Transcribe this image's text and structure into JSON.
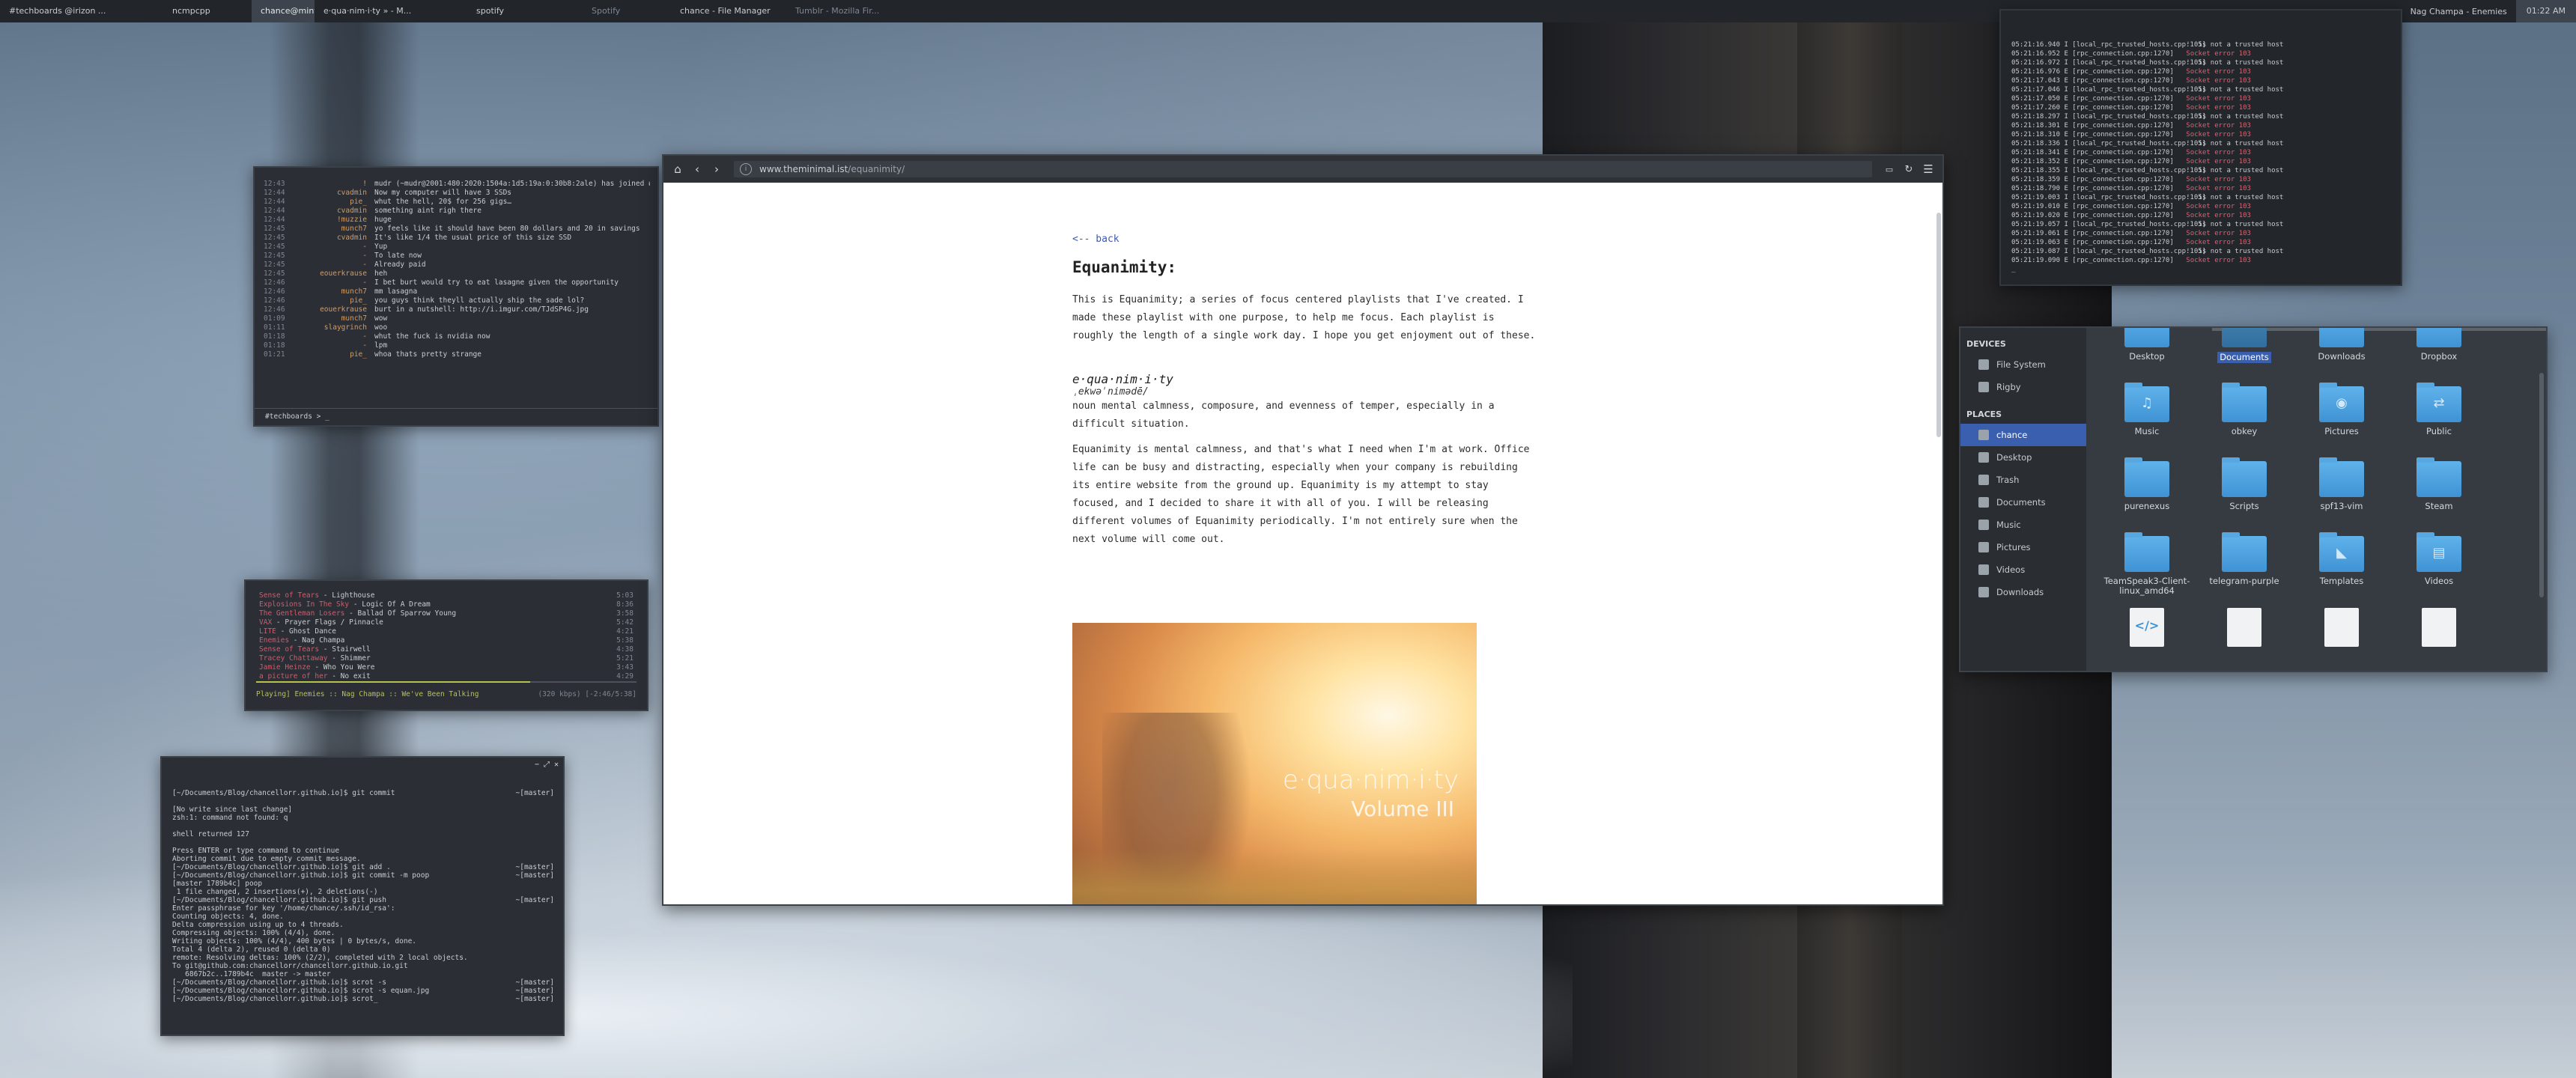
{
  "topbar": {
    "tabs": [
      "#techboards @irizon ...",
      "ncmpcpp",
      "chance@mintyfresh: ~",
      "e·qua·nim·i·ty » - M...",
      "spotify",
      "Spotify",
      "chance - File Manager",
      "Tumblr - Mozilla Fir..."
    ],
    "now_playing": "Nag Champa - Enemies",
    "clock": "01:22 AM"
  },
  "irc": {
    "lines": [
      {
        "t": "12:43",
        "n": "!",
        "m": "mudr (~mudr@2001:480:2020:1504a:1d5:19a:0:30b8:2ale) has joined #techboards"
      },
      {
        "t": "12:44",
        "n": "cvadmin",
        "m": "Now my computer will have 3 SSDs"
      },
      {
        "t": "12:44",
        "n": "pie_",
        "m": "whut the hell, 20$ for 256 gigs…"
      },
      {
        "t": "12:44",
        "n": "cvadmin",
        "m": "something aint righ there"
      },
      {
        "t": "12:44",
        "n": "!muzzie",
        "m": "huge"
      },
      {
        "t": "12:45",
        "n": "munch7",
        "m": "yo feels like it should have been 80 dollars and 20 in savings"
      },
      {
        "t": "12:45",
        "n": "cvadmin",
        "m": "It's like 1/4 the usual price of this size SSD"
      },
      {
        "t": "12:45",
        "n": "-",
        "m": "Yup"
      },
      {
        "t": "12:45",
        "n": "-",
        "m": "To late now"
      },
      {
        "t": "12:45",
        "n": "-",
        "m": "Already paid"
      },
      {
        "t": "12:45",
        "n": "eouerkrause",
        "m": "heh"
      },
      {
        "t": "12:46",
        "n": "-",
        "m": "I bet burt would try to eat lasagne given the opportunity"
      },
      {
        "t": "12:46",
        "n": "munch7",
        "m": "mm lasagna"
      },
      {
        "t": "12:46",
        "n": "pie_",
        "m": "you guys think theyll actually ship the sade lol?"
      },
      {
        "t": "12:46",
        "n": "eouerkrause",
        "m": "burt in a nutshell: http://i.imgur.com/TJdSP4G.jpg"
      },
      {
        "t": "01:09",
        "n": "munch7",
        "m": "wow"
      },
      {
        "t": "01:11",
        "n": "slaygrinch",
        "m": "woo"
      },
      {
        "t": "01:18",
        "n": "-",
        "m": "whut the fuck is nvidia now"
      },
      {
        "t": "01:18",
        "n": "-",
        "m": "lpm"
      },
      {
        "t": "01:21",
        "n": "pie_",
        "m": "whoa thats pretty strange"
      }
    ],
    "input": "#techboards > _"
  },
  "music": {
    "tracks": [
      {
        "artist": "Sense of Tears",
        "song": " - Lighthouse",
        "dur": "5:03"
      },
      {
        "artist": "Explosions In The Sky",
        "song": " - Logic Of A Dream",
        "dur": "8:36"
      },
      {
        "artist": "The Gentleman Losers",
        "song": " - Ballad Of Sparrow Young",
        "dur": "3:58"
      },
      {
        "artist": "VAX",
        "song": " - Prayer Flags / Pinnacle",
        "dur": "5:42"
      },
      {
        "artist": "LITE",
        "song": " - Ghost Dance",
        "dur": "4:21"
      },
      {
        "artist": "Enemies",
        "song": " - Nag Champa",
        "dur": "5:38"
      },
      {
        "artist": "Sense of Tears",
        "song": " - Stairwell",
        "dur": "4:38"
      },
      {
        "artist": "Tracey Chattaway",
        "song": " - Shimmer",
        "dur": "5:21"
      },
      {
        "artist": "Jamie Heinze",
        "song": " - Who You Were",
        "dur": "3:43"
      },
      {
        "artist": "a picture of her",
        "song": " - No exit",
        "dur": "4:29"
      }
    ],
    "progress": 0.72,
    "status": "Playing] Enemies :: Nag Champa :: We've Been Talking",
    "status_right": "(320 kbps) [-2:46/5:38]"
  },
  "git": {
    "controls": [
      "−",
      "⤢",
      "✕"
    ],
    "lines": [
      {
        "c": "[~/Documents/Blog/chancellorr.github.io]$ git commit",
        "p": "~[master]"
      },
      {
        "c": "",
        "p": ""
      },
      {
        "c": "[No write since last change]",
        "p": ""
      },
      {
        "c": "zsh:1: command not found: q",
        "p": ""
      },
      {
        "c": "",
        "p": ""
      },
      {
        "c": "shell returned 127",
        "p": ""
      },
      {
        "c": "",
        "p": ""
      },
      {
        "c": "Press ENTER or type command to continue",
        "p": ""
      },
      {
        "c": "Aborting commit due to empty commit message.",
        "p": ""
      },
      {
        "c": "[~/Documents/Blog/chancellorr.github.io]$ git add .",
        "p": "~[master]"
      },
      {
        "c": "[~/Documents/Blog/chancellorr.github.io]$ git commit -m poop",
        "p": "~[master]"
      },
      {
        "c": "[master 1789b4c] poop",
        "p": ""
      },
      {
        "c": " 1 file changed, 2 insertions(+), 2 deletions(-)",
        "p": ""
      },
      {
        "c": "[~/Documents/Blog/chancellorr.github.io]$ git push",
        "p": "~[master]"
      },
      {
        "c": "Enter passphrase for key '/home/chance/.ssh/id_rsa':",
        "p": ""
      },
      {
        "c": "Counting objects: 4, done.",
        "p": ""
      },
      {
        "c": "Delta compression using up to 4 threads.",
        "p": ""
      },
      {
        "c": "Compressing objects: 100% (4/4), done.",
        "p": ""
      },
      {
        "c": "Writing objects: 100% (4/4), 400 bytes | 0 bytes/s, done.",
        "p": ""
      },
      {
        "c": "Total 4 (delta 2), reused 0 (delta 0)",
        "p": ""
      },
      {
        "c": "remote: Resolving deltas: 100% (2/2), completed with 2 local objects.",
        "p": ""
      },
      {
        "c": "To git@github.com:chancellorr/chancellorr.github.io.git",
        "p": ""
      },
      {
        "c": "   6867b2c..1789b4c  master -> master",
        "p": ""
      },
      {
        "c": "[~/Documents/Blog/chancellorr.github.io]$ scrot -s",
        "p": "~[master]"
      },
      {
        "c": "[~/Documents/Blog/chancellorr.github.io]$ scrot -s equan.jpg",
        "p": "~[master]"
      },
      {
        "c": "[~/Documents/Blog/chancellorr.github.io]$ scrot_",
        "p": "~[master]"
      }
    ]
  },
  "log": {
    "lines": [
      {
        "ts": "05:21:16.940 I",
        "src": "[local_rpc_trusted_hosts.cpp:105]",
        "msg": "'' is not a trusted host",
        "err": false
      },
      {
        "ts": "05:21:16.952 E",
        "src": "[rpc_connection.cpp:1270]",
        "msg": "Socket error 103",
        "err": true
      },
      {
        "ts": "05:21:16.972 I",
        "src": "[local_rpc_trusted_hosts.cpp:105]",
        "msg": "'' is not a trusted host",
        "err": false
      },
      {
        "ts": "05:21:16.976 E",
        "src": "[rpc_connection.cpp:1270]",
        "msg": "Socket error 103",
        "err": true
      },
      {
        "ts": "05:21:17.043 E",
        "src": "[rpc_connection.cpp:1270]",
        "msg": "Socket error 103",
        "err": true
      },
      {
        "ts": "05:21:17.046 I",
        "src": "[local_rpc_trusted_hosts.cpp:105]",
        "msg": "'' is not a trusted host",
        "err": false
      },
      {
        "ts": "05:21:17.050 E",
        "src": "[rpc_connection.cpp:1270]",
        "msg": "Socket error 103",
        "err": true
      },
      {
        "ts": "05:21:17.260 E",
        "src": "[rpc_connection.cpp:1270]",
        "msg": "Socket error 103",
        "err": true
      },
      {
        "ts": "05:21:18.297 I",
        "src": "[local_rpc_trusted_hosts.cpp:105]",
        "msg": "'' is not a trusted host",
        "err": false
      },
      {
        "ts": "05:21:18.301 E",
        "src": "[rpc_connection.cpp:1270]",
        "msg": "Socket error 103",
        "err": true
      },
      {
        "ts": "05:21:18.310 E",
        "src": "[rpc_connection.cpp:1270]",
        "msg": "Socket error 103",
        "err": true
      },
      {
        "ts": "05:21:18.336 I",
        "src": "[local_rpc_trusted_hosts.cpp:105]",
        "msg": "'' is not a trusted host",
        "err": false
      },
      {
        "ts": "05:21:18.341 E",
        "src": "[rpc_connection.cpp:1270]",
        "msg": "Socket error 103",
        "err": true
      },
      {
        "ts": "05:21:18.352 E",
        "src": "[rpc_connection.cpp:1270]",
        "msg": "Socket error 103",
        "err": true
      },
      {
        "ts": "05:21:18.355 I",
        "src": "[local_rpc_trusted_hosts.cpp:105]",
        "msg": "'' is not a trusted host",
        "err": false
      },
      {
        "ts": "05:21:18.359 E",
        "src": "[rpc_connection.cpp:1270]",
        "msg": "Socket error 103",
        "err": true
      },
      {
        "ts": "05:21:18.790 E",
        "src": "[rpc_connection.cpp:1270]",
        "msg": "Socket error 103",
        "err": true
      },
      {
        "ts": "05:21:19.003 I",
        "src": "[local_rpc_trusted_hosts.cpp:105]",
        "msg": "'' is not a trusted host",
        "err": false
      },
      {
        "ts": "05:21:19.010 E",
        "src": "[rpc_connection.cpp:1270]",
        "msg": "Socket error 103",
        "err": true
      },
      {
        "ts": "05:21:19.020 E",
        "src": "[rpc_connection.cpp:1270]",
        "msg": "Socket error 103",
        "err": true
      },
      {
        "ts": "05:21:19.057 I",
        "src": "[local_rpc_trusted_hosts.cpp:105]",
        "msg": "'' is not a trusted host",
        "err": false
      },
      {
        "ts": "05:21:19.061 E",
        "src": "[rpc_connection.cpp:1270]",
        "msg": "Socket error 103",
        "err": true
      },
      {
        "ts": "05:21:19.063 E",
        "src": "[rpc_connection.cpp:1270]",
        "msg": "Socket error 103",
        "err": true
      },
      {
        "ts": "05:21:19.087 I",
        "src": "[local_rpc_trusted_hosts.cpp:105]",
        "msg": "'' is not a trusted host",
        "err": false
      },
      {
        "ts": "05:21:19.090 E",
        "src": "[rpc_connection.cpp:1270]",
        "msg": "Socket error 103",
        "err": true
      },
      {
        "ts": "_",
        "src": "",
        "msg": "",
        "err": false
      }
    ]
  },
  "browser": {
    "url_host": "www.theminimal.ist",
    "url_path": "/equanimity/",
    "back_link": "<-- back",
    "title": "Equanimity:",
    "intro": "This is Equanimity; a series of focus centered playlists that I've created. I made these playlist with one purpose, to help me focus. Each playlist is roughly the length of a single work day. I hope you get enjoyment out of these.",
    "word": "e·qua·nim·i·ty",
    "pronunciation": "ˌekwəˈnimədē/",
    "definition": "noun mental calmness, composure, and evenness of temper, especially in a difficult situation.",
    "body": "Equanimity is mental calmness, and that's what I need when I'm at work. Office life can be busy and distracting, especially when your company is rebuilding its entire website from the ground up. Equanimity is my attempt to stay focused, and I decided to share it with all of you. I will be releasing different volumes of Equanimity periodically. I'm not entirely sure when the next volume will come out.",
    "cover_title": "e·qua·nim·i·ty",
    "cover_volume": "Volume III"
  },
  "fm": {
    "devices_header": "DEVICES",
    "devices": [
      "File System",
      "Rigby"
    ],
    "places_header": "PLACES",
    "places": [
      "chance",
      "Desktop",
      "Trash",
      "Documents",
      "Music",
      "Pictures",
      "Videos",
      "Downloads"
    ],
    "items": [
      {
        "label": "Desktop",
        "glyph": ""
      },
      {
        "label": "Documents",
        "glyph": ""
      },
      {
        "label": "Downloads",
        "glyph": ""
      },
      {
        "label": "Dropbox",
        "glyph": ""
      },
      {
        "label": "Music",
        "glyph": "♫"
      },
      {
        "label": "obkey",
        "glyph": ""
      },
      {
        "label": "Pictures",
        "glyph": "◉"
      },
      {
        "label": "Public",
        "glyph": "⇄"
      },
      {
        "label": "purenexus",
        "glyph": ""
      },
      {
        "label": "Scripts",
        "glyph": ""
      },
      {
        "label": "spf13-vim",
        "glyph": ""
      },
      {
        "label": "Steam",
        "glyph": ""
      },
      {
        "label": "TeamSpeak3-Client-linux_amd64",
        "glyph": ""
      },
      {
        "label": "telegram-purple",
        "glyph": ""
      },
      {
        "label": "Templates",
        "glyph": "◣"
      },
      {
        "label": "Videos",
        "glyph": "▤"
      }
    ],
    "file_glyphs": [
      "</>",
      "",
      "",
      ""
    ]
  }
}
